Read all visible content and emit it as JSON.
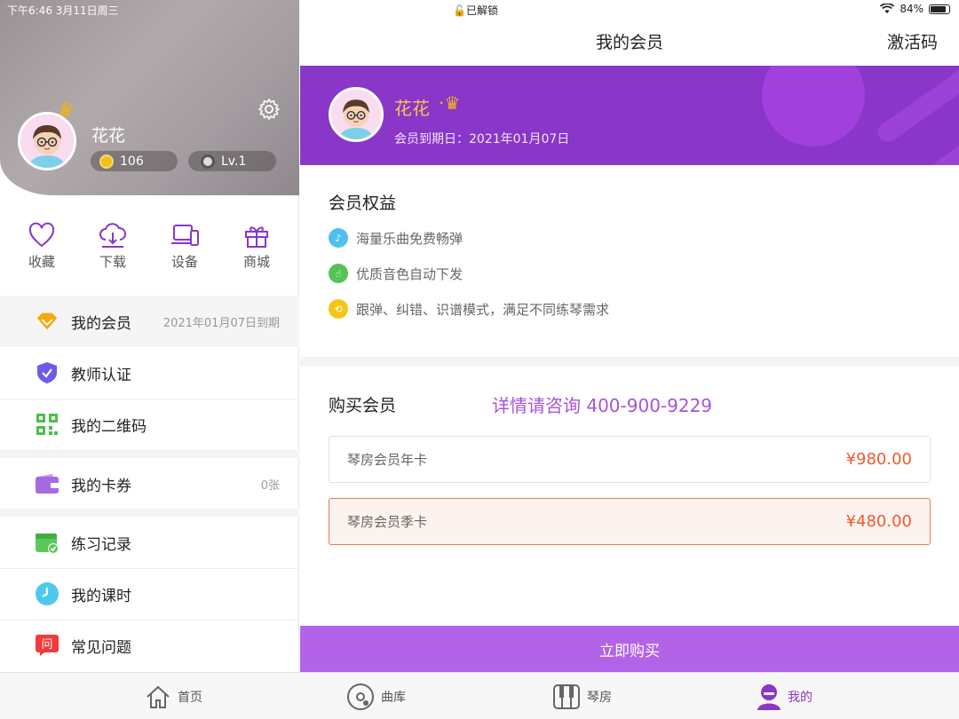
{
  "status_bar": {
    "time_date": "下午6:46   3月11日周三",
    "lock_text": "已解锁",
    "battery": "84%",
    "battery_level": 0.84
  },
  "profile": {
    "name": "花花",
    "coins": "106",
    "level": "Lv.1",
    "crown_badge": "vip"
  },
  "quick_actions": [
    {
      "label": "收藏",
      "icon": "heart-icon"
    },
    {
      "label": "下载",
      "icon": "cloud-download-icon"
    },
    {
      "label": "设备",
      "icon": "devices-icon"
    },
    {
      "label": "商城",
      "icon": "gift-icon"
    }
  ],
  "menu": [
    {
      "label": "我的会员",
      "value": "2021年01月07日到期",
      "icon": "diamond-icon"
    },
    {
      "label": "教师认证",
      "value": "",
      "icon": "shield-icon"
    },
    {
      "label": "我的二维码",
      "value": "",
      "icon": "qrcode-icon"
    },
    {
      "label": "我的卡券",
      "value": "0张",
      "icon": "wallet-icon"
    },
    {
      "label": "练习记录",
      "value": "",
      "icon": "calendar-icon"
    },
    {
      "label": "我的课时",
      "value": "",
      "icon": "clock-icon"
    },
    {
      "label": "常见问题",
      "value": "",
      "icon": "question-icon"
    }
  ],
  "header": {
    "title": "我的会员",
    "activate_label": "激活码"
  },
  "banner": {
    "name": "花花",
    "expire": "会员到期日：2021年01月07日"
  },
  "benefits": {
    "title": "会员权益",
    "items": [
      "海量乐曲免费畅弹",
      "优质音色自动下发",
      "跟弹、纠错、识谱模式，满足不同练琴需求"
    ]
  },
  "purchase": {
    "title": "购买会员",
    "consult": "详情请咨询  400-900-9229",
    "plans": [
      {
        "name": "琴房会员年卡",
        "price": "¥980.00",
        "selected": false
      },
      {
        "name": "琴房会员季卡",
        "price": "¥480.00",
        "selected": true
      }
    ],
    "buy_label": "立即购买"
  },
  "tabbar": [
    {
      "label": "首页",
      "icon": "home-icon",
      "active": false
    },
    {
      "label": "曲库",
      "icon": "disc-icon",
      "active": false
    },
    {
      "label": "琴房",
      "icon": "piano-icon",
      "active": false
    },
    {
      "label": "我的",
      "icon": "person-icon",
      "active": true
    }
  ],
  "colors": {
    "accent_purple": "#8a36c9",
    "button_purple": "#b263e7",
    "price_orange": "#ee5a30",
    "gold": "#f8c54c"
  }
}
